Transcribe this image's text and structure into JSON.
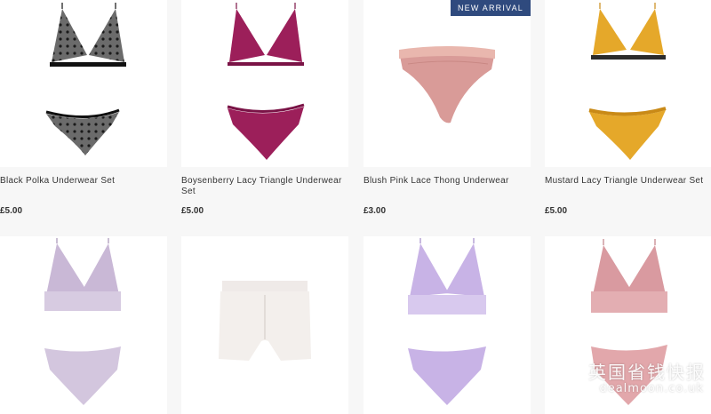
{
  "products": [
    {
      "title": "Black Polka Underwear Set",
      "price": "£5.00",
      "image": "black-polka-set"
    },
    {
      "title": "Boysenberry Lacy Triangle Underwear Set",
      "price": "£5.00",
      "image": "boysenberry-lace-set"
    },
    {
      "title": "Blush Pink Lace Thong Underwear",
      "price": "£3.00",
      "image": "blush-pink-thong",
      "badge": "NEW ARRIVAL"
    },
    {
      "title": "Mustard Lacy Triangle Underwear Set",
      "price": "£5.00",
      "image": "mustard-lace-set"
    },
    {
      "image": "lilac-lace-bralette-set"
    },
    {
      "image": "white-boxer-brief"
    },
    {
      "image": "lavender-lace-bralette-set"
    },
    {
      "image": "pink-lace-bralette-set"
    }
  ],
  "watermark": {
    "brand": "英国省钱快报",
    "site": "dealmoon.co.uk"
  }
}
